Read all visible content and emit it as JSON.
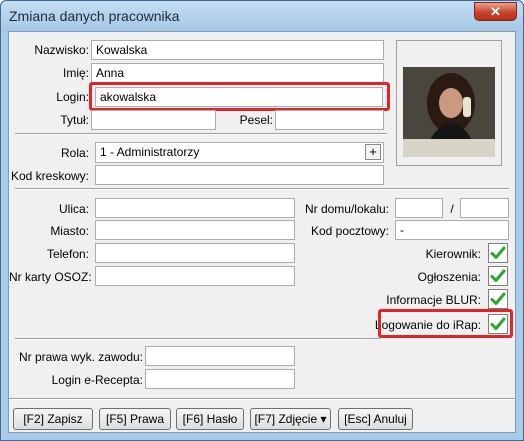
{
  "window": {
    "title": "Zmiana danych pracownika",
    "close_glyph": "✕"
  },
  "form": {
    "nazwisko": {
      "label": "Nazwisko:",
      "value": "Kowalska"
    },
    "imie": {
      "label": "Imię:",
      "value": "Anna"
    },
    "login": {
      "label": "Login:",
      "value": "akowalska"
    },
    "tytul": {
      "label": "Tytuł:",
      "value": ""
    },
    "pesel": {
      "label": "Pesel:",
      "value": ""
    },
    "rola": {
      "label": "Rola:",
      "value": "1 - Administratorzy",
      "picker_glyph": "+"
    },
    "kod_kreskowy": {
      "label": "Kod kreskowy:",
      "value": ""
    },
    "ulica": {
      "label": "Ulica:",
      "value": ""
    },
    "nr_domu": {
      "label": "Nr domu/lokalu:",
      "value_house": "",
      "separator": "/",
      "value_flat": ""
    },
    "miasto": {
      "label": "Miasto:",
      "value": ""
    },
    "kod_pocztowy": {
      "label": "Kod pocztowy:",
      "value": "-"
    },
    "telefon": {
      "label": "Telefon:",
      "value": ""
    },
    "nr_karty_osoz": {
      "label": "Nr karty OSOZ:",
      "value": ""
    },
    "nr_prawa": {
      "label": "Nr prawa wyk. zawodu:",
      "value": ""
    },
    "login_erecepta": {
      "label": "Login e-Recepta:",
      "value": ""
    }
  },
  "checks": {
    "kierownik": {
      "label": "Kierownik:",
      "checked": true
    },
    "ogloszenia": {
      "label": "Ogłoszenia:",
      "checked": true
    },
    "informacje_blur": {
      "label": "Informacje BLUR:",
      "checked": true
    },
    "logowanie_irap": {
      "label": "Logowanie do iRap:",
      "checked": true
    }
  },
  "buttons": {
    "zapisz": "[F2] Zapisz",
    "prawa": "[F5] Prawa",
    "haslo": "[F6] Hasło",
    "zdjecie": "[F7] Zdjęcie",
    "zdjecie_arrow": "▾",
    "anuluj": "[Esc] Anuluj"
  },
  "colors": {
    "highlight": "#e0262a",
    "check_green": "#2fa32f",
    "titlebar": "#a9cbe8"
  },
  "icons": {
    "check": "checkmark-icon",
    "photo": "employee-photo"
  }
}
